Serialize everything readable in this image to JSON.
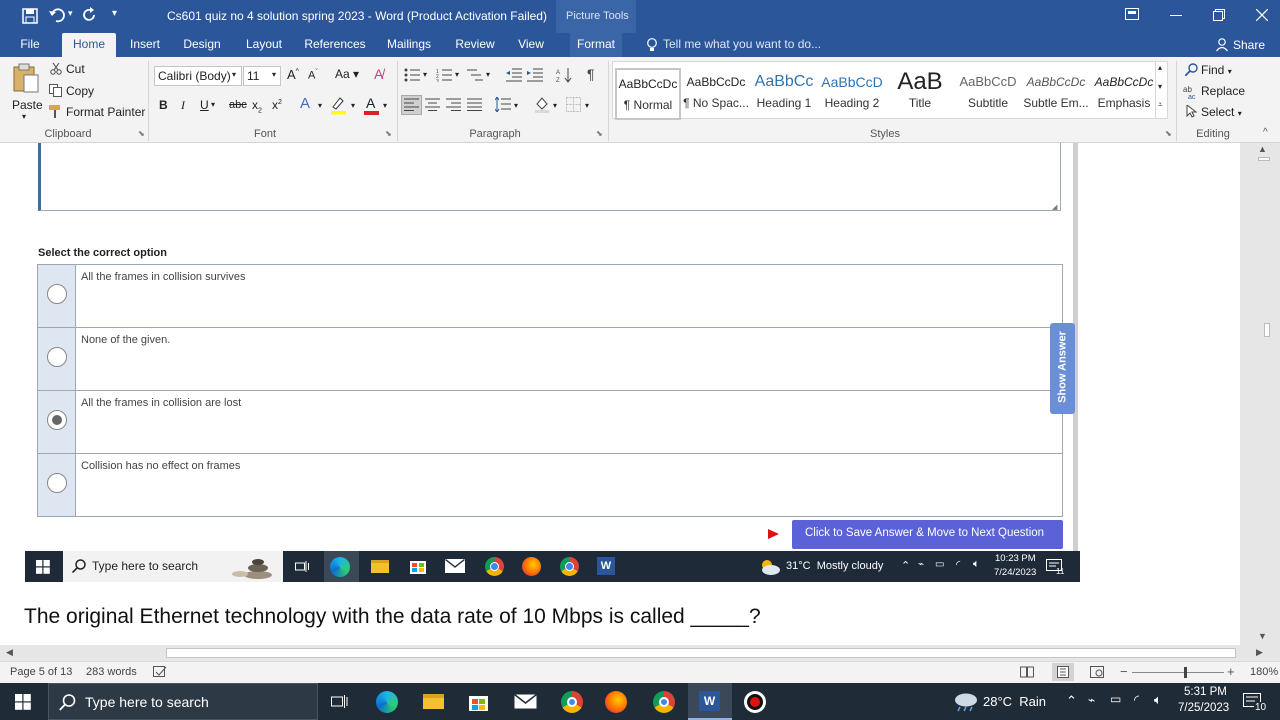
{
  "window": {
    "title": "Cs601 quiz no 4 solution spring 2023 - Word (Product Activation Failed)",
    "context_tab": "Picture Tools",
    "share_label": "Share",
    "tell_me": "Tell me what you want to do..."
  },
  "tabs": [
    "File",
    "Home",
    "Insert",
    "Design",
    "Layout",
    "References",
    "Mailings",
    "Review",
    "View",
    "Format"
  ],
  "clipboard": {
    "paste": "Paste",
    "cut": "Cut",
    "copy": "Copy",
    "format_painter": "Format Painter",
    "group": "Clipboard"
  },
  "font": {
    "name": "Calibri (Body)",
    "size": "11",
    "group": "Font",
    "case_btn": "Aa"
  },
  "paragraph": {
    "group": "Paragraph"
  },
  "styles": {
    "group": "Styles",
    "items": [
      {
        "preview": "AaBbCcDc",
        "name": "¶ Normal"
      },
      {
        "preview": "AaBbCcDc",
        "name": "¶ No Spac..."
      },
      {
        "preview": "AaBbCc",
        "name": "Heading 1"
      },
      {
        "preview": "AaBbCcD",
        "name": "Heading 2"
      },
      {
        "preview": "AaB",
        "name": "Title"
      },
      {
        "preview": "AaBbCcD",
        "name": "Subtitle"
      },
      {
        "preview": "AaBbCcDc",
        "name": "Subtle Em..."
      },
      {
        "preview": "AaBbCcDc",
        "name": "Emphasis"
      }
    ]
  },
  "editing": {
    "find": "Find",
    "replace": "Replace",
    "select": "Select",
    "group": "Editing"
  },
  "quiz": {
    "prompt": "Select the correct option",
    "options": [
      "All the frames in collision survives",
      "None of the given.",
      "All the frames in collision are lost",
      "Collision has no effect on frames"
    ],
    "selected_index": 2,
    "show_answer": "Show Answer",
    "save_button": "Click to Save Answer & Move to Next Question"
  },
  "inner_taskbar": {
    "search": "Type here to search",
    "weather": "31°C  Mostly cloudy",
    "time": "10:23 PM",
    "date": "7/24/2023",
    "notif": "11"
  },
  "question": "The original Ethernet technology with the data rate of 10 Mbps is called _____?",
  "status": {
    "page": "Page 5 of 13",
    "words": "283 words",
    "zoom": "180%"
  },
  "taskbar": {
    "search": "Type here to search",
    "weather": "28°C  Rain",
    "time": "5:31 PM",
    "date": "7/25/2023",
    "notif": "10"
  },
  "colors": {
    "word_blue": "#2b579a",
    "button_purple": "#5b61d6",
    "taskbar": "#202b38"
  }
}
